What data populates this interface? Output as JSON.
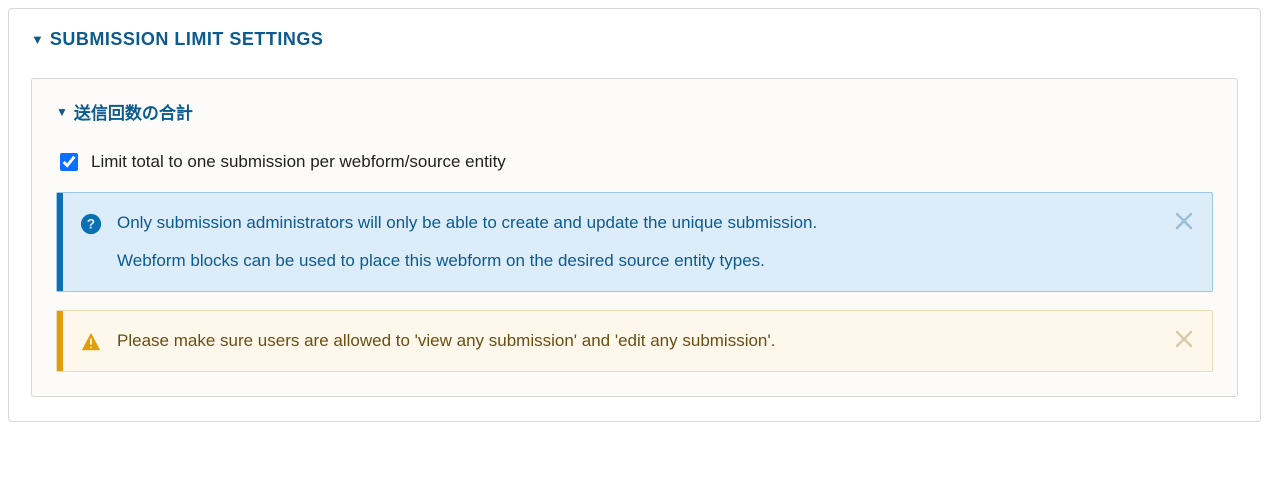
{
  "section": {
    "title": "SUBMISSION LIMIT SETTINGS"
  },
  "subsection": {
    "title": "送信回数の合計"
  },
  "checkbox": {
    "label": "Limit total to one submission per webform/source entity",
    "checked": true
  },
  "info_alert": {
    "line1": "Only submission administrators will only be able to create and update the unique submission.",
    "line2": "Webform blocks can be used to place this webform on the desired source entity types."
  },
  "warn_alert": {
    "text": "Please make sure users are allowed to 'view any submission' and 'edit any submission'."
  }
}
